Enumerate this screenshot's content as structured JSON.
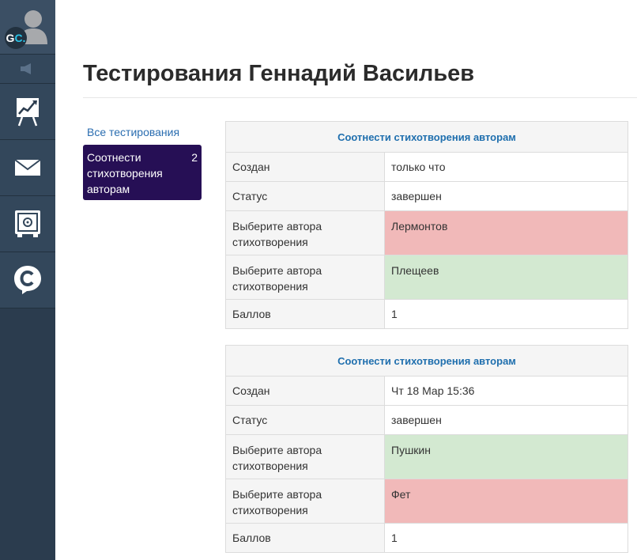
{
  "sidebar": {
    "avatar": {
      "initials_main": "G",
      "initials_accent": "C."
    },
    "items": [
      {
        "name": "announcements",
        "icon": "speaker-icon"
      },
      {
        "name": "presentation",
        "icon": "chart-board-icon"
      },
      {
        "name": "messages",
        "icon": "mail-icon"
      },
      {
        "name": "safe",
        "icon": "safe-icon"
      },
      {
        "name": "chat",
        "icon": "chat-c-icon"
      }
    ]
  },
  "page": {
    "title": "Тестирования Геннадий Васильев"
  },
  "nav": {
    "all_tests": "Все тестирования",
    "active": {
      "label": "Соотнести стихотворения авторам",
      "count": "2"
    }
  },
  "results": [
    {
      "title": "Соотнести стихотворения авторам",
      "rows": [
        {
          "key": "Создан",
          "value": "только что",
          "status": ""
        },
        {
          "key": "Статус",
          "value": "завершен",
          "status": ""
        },
        {
          "key": "Выберите автора стихотворения",
          "value": "Лермонтов",
          "status": "incorrect"
        },
        {
          "key": "Выберите автора стихотворения",
          "value": "Плещеев",
          "status": "correct"
        },
        {
          "key": "Баллов",
          "value": "1",
          "status": ""
        }
      ]
    },
    {
      "title": "Соотнести стихотворения авторам",
      "rows": [
        {
          "key": "Создан",
          "value": "Чт 18 Мар 15:36",
          "status": ""
        },
        {
          "key": "Статус",
          "value": "завершен",
          "status": ""
        },
        {
          "key": "Выберите автора стихотворения",
          "value": "Пушкин",
          "status": "correct"
        },
        {
          "key": "Выберите автора стихотворения",
          "value": "Фет",
          "status": "incorrect"
        },
        {
          "key": "Баллов",
          "value": "1",
          "status": ""
        }
      ]
    }
  ],
  "colors": {
    "sidebar": "#2b3c4e",
    "active": "#260f55",
    "link": "#2a6db0",
    "incorrect": "#f1b9b9",
    "correct": "#d3e9d1"
  }
}
